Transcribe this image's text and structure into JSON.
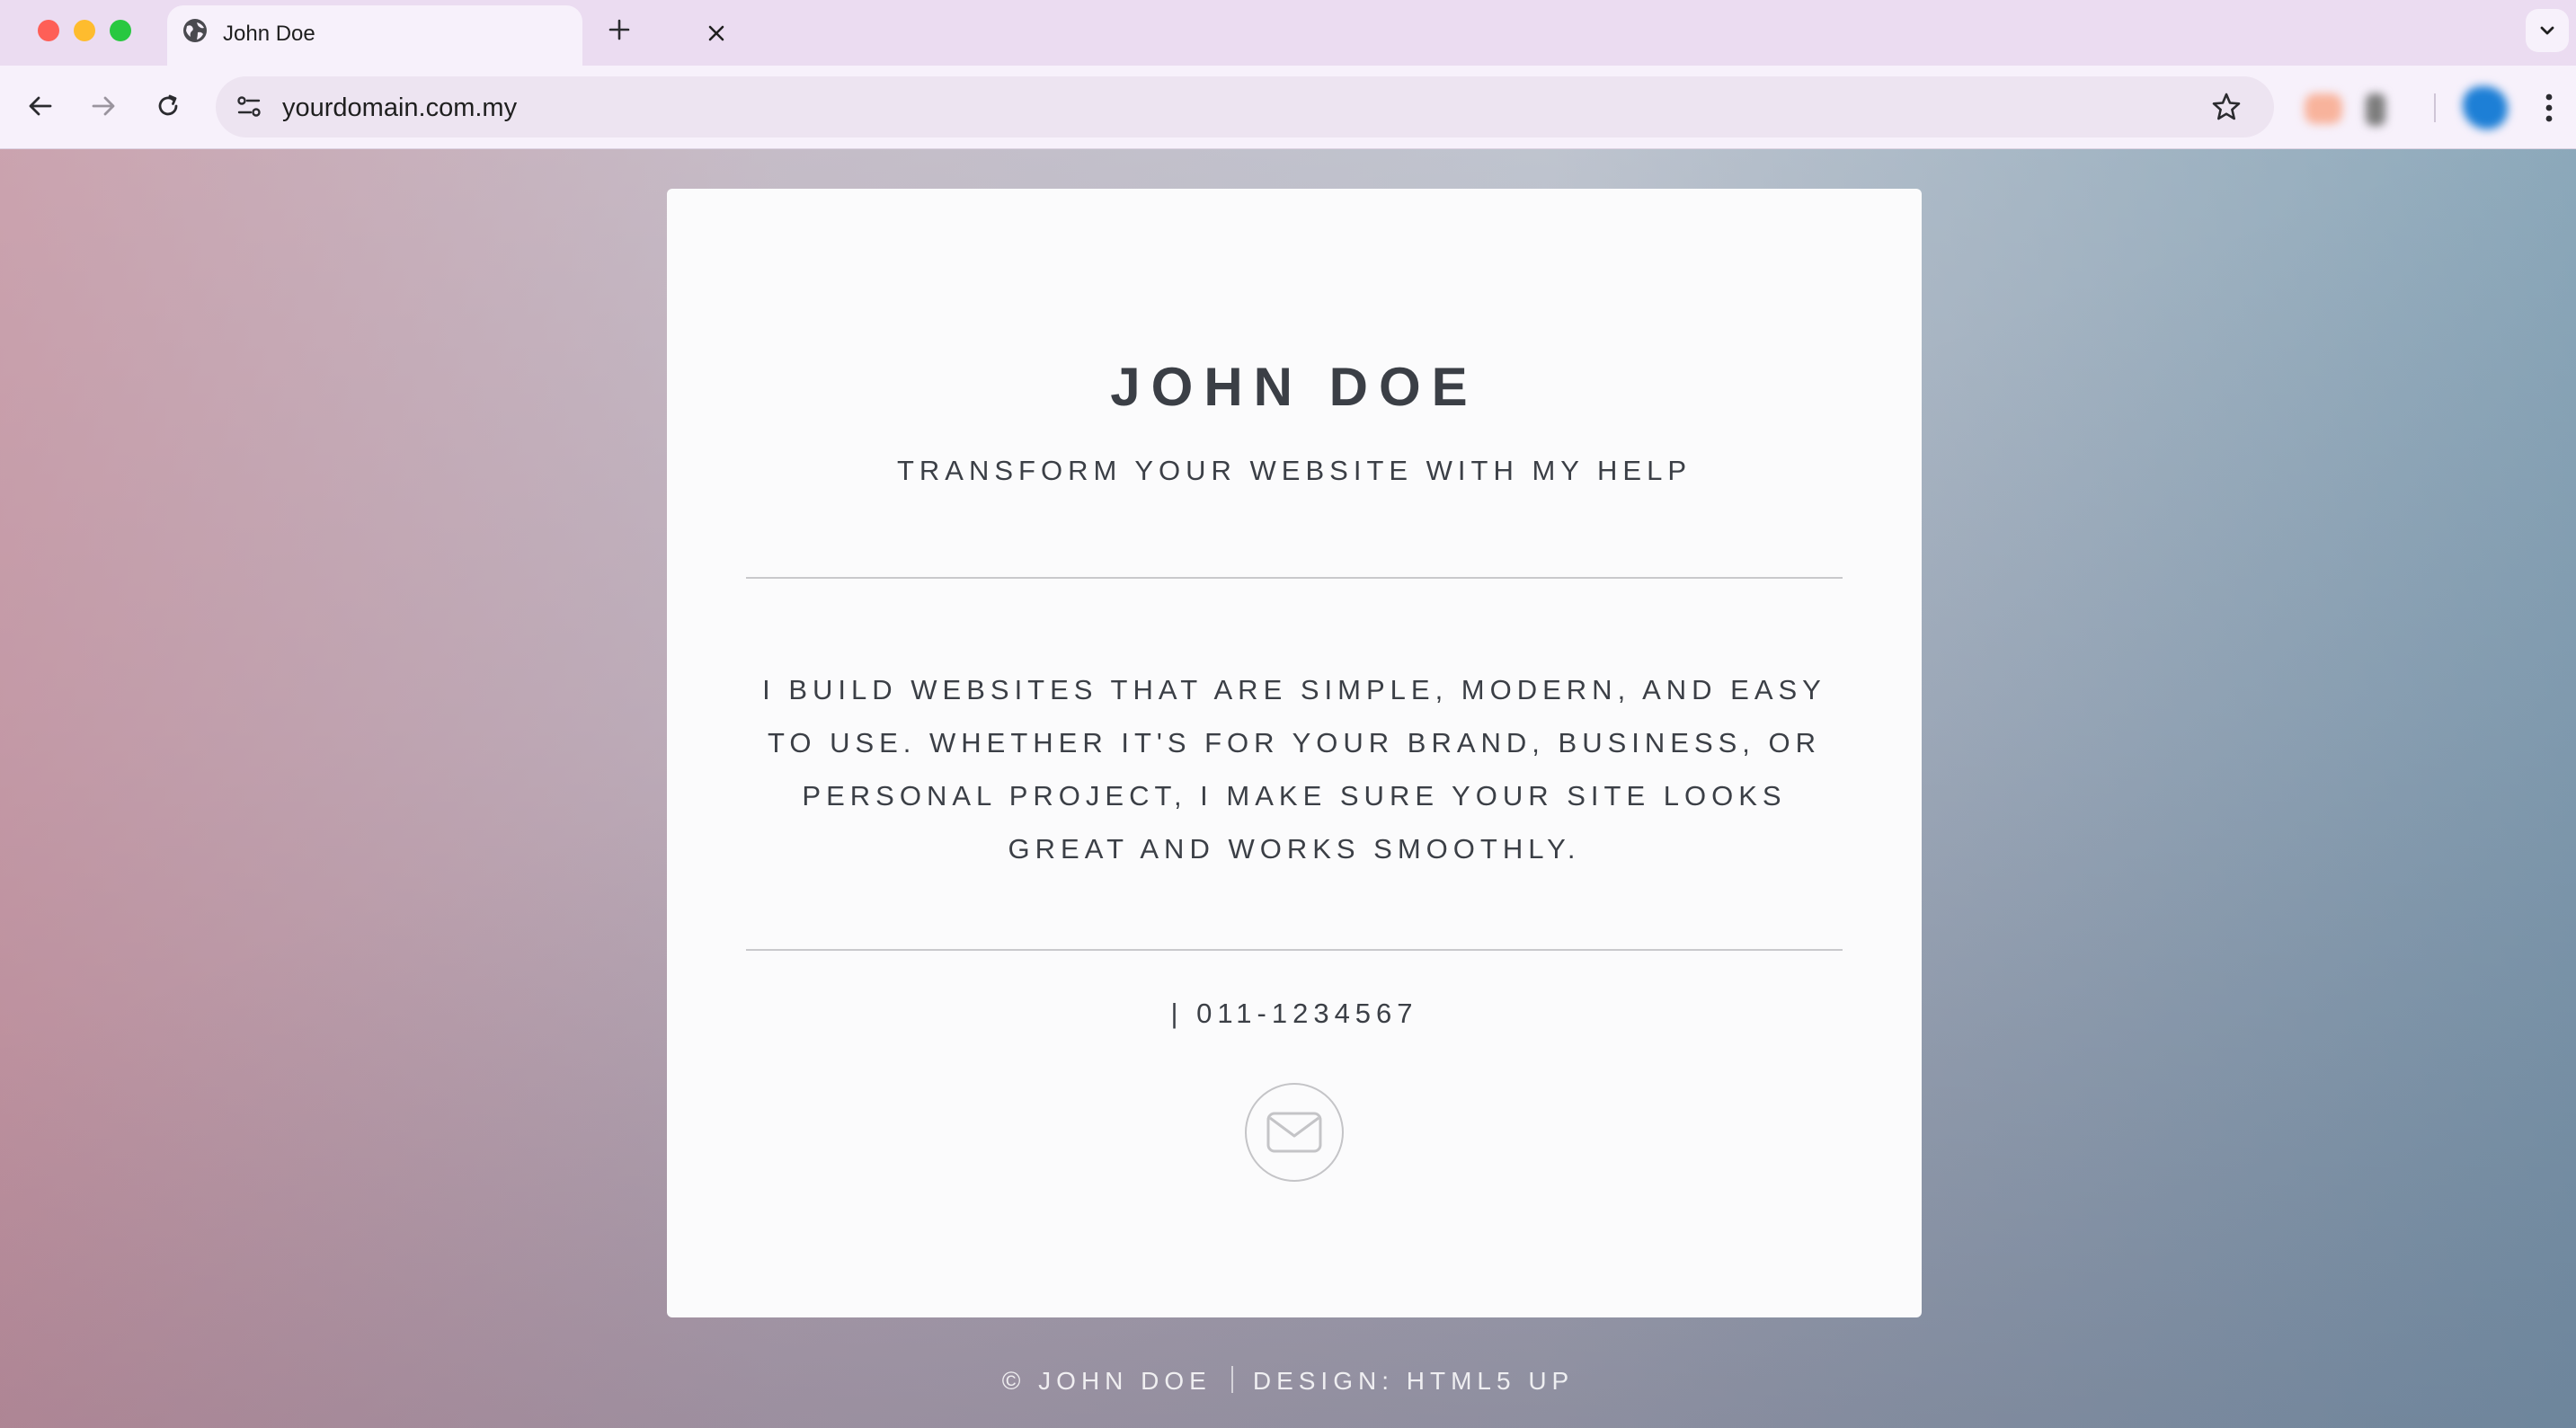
{
  "browser": {
    "tab": {
      "title": "John Doe"
    },
    "address_bar": {
      "url": "yourdomain.com.my"
    },
    "colors": {
      "tabstrip": "#ebdcf1",
      "toolbar": "#f7f1fb",
      "omnibox": "#ede4f1"
    },
    "icons": [
      "globe-icon",
      "close-icon",
      "plus-icon",
      "chevron-down-icon",
      "arrow-left-icon",
      "arrow-right-icon",
      "reload-icon",
      "site-settings-icon",
      "star-icon",
      "kebab-menu-icon"
    ]
  },
  "page": {
    "name": "JOHN DOE",
    "tagline": "TRANSFORM YOUR WEBSITE WITH MY HELP",
    "bio": "I BUILD WEBSITES THAT ARE SIMPLE, MODERN, AND EASY TO USE. WHETHER IT'S FOR YOUR BRAND, BUSINESS, OR PERSONAL PROJECT, I MAKE SURE YOUR SITE LOOKS GREAT AND WORKS SMOOTHLY.",
    "phone": "| 011-1234567",
    "email_icon": "envelope-icon",
    "footer": {
      "copyright": "© JOHN DOE",
      "design": "DESIGN: HTML5 UP"
    }
  }
}
